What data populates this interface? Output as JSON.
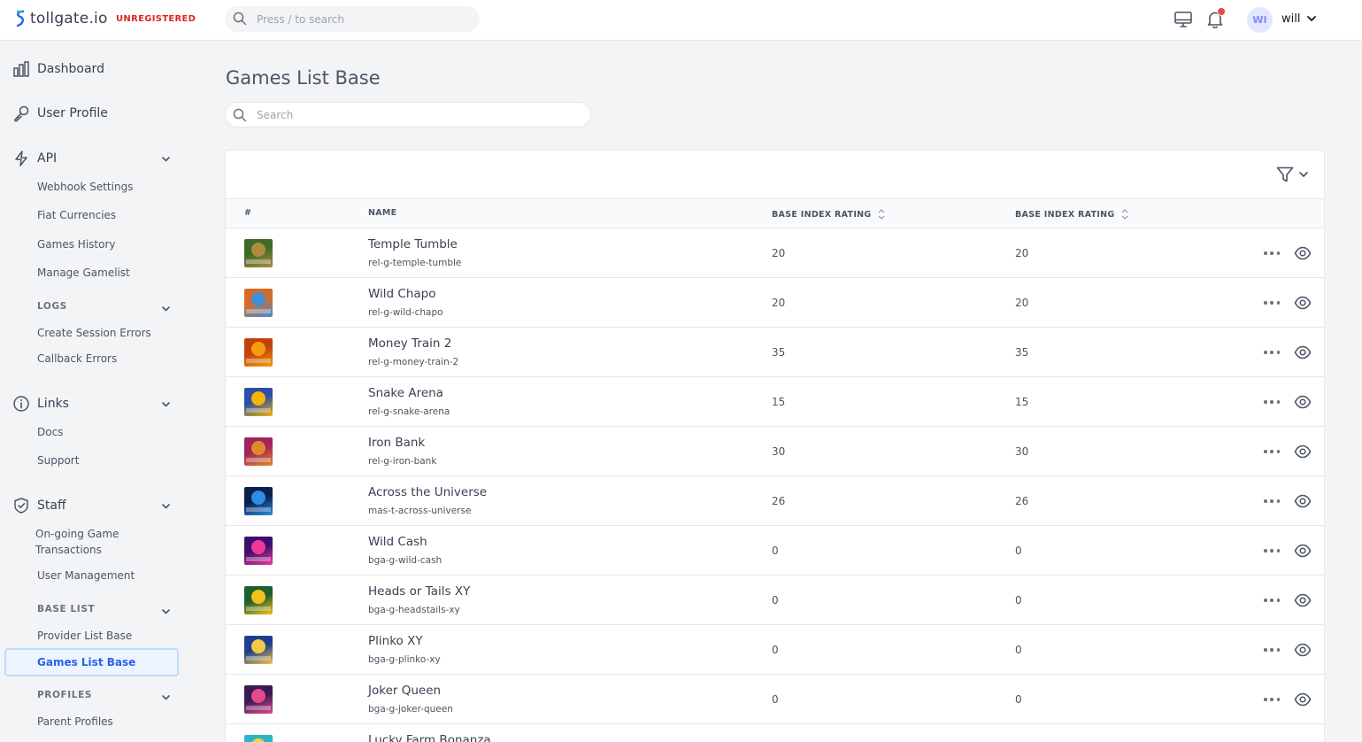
{
  "header": {
    "logo_text": "tollgate.io",
    "badge": "UNREGISTERED",
    "search_placeholder": "Press / to search",
    "avatar_initials": "WI",
    "username": "will"
  },
  "sidebar": {
    "dashboard": "Dashboard",
    "user_profile": "User Profile",
    "api": "API",
    "api_items": [
      "Webhook Settings",
      "Fiat Currencies",
      "Games History",
      "Manage Gamelist"
    ],
    "logs_section": "LOGS",
    "logs_items": [
      "Create Session Errors",
      "Callback Errors"
    ],
    "links": "Links",
    "links_items": [
      "Docs",
      "Support"
    ],
    "staff": "Staff",
    "staff_items": [
      "On-going Game Transactions",
      "User Management"
    ],
    "base_list_section": "BASE LIST",
    "base_list_items": [
      "Provider List Base",
      "Games List Base"
    ],
    "profiles_section": "PROFILES",
    "profiles_items": [
      "Parent Profiles"
    ]
  },
  "main": {
    "title": "Games List Base",
    "search_placeholder": "Search",
    "columns": [
      "#",
      "NAME",
      "BASE INDEX RATING",
      "BASE INDEX RATING"
    ],
    "rows": [
      {
        "name": "Temple Tumble",
        "slug": "rel-g-temple-tumble",
        "rating1": "20",
        "rating2": "20"
      },
      {
        "name": "Wild Chapo",
        "slug": "rel-g-wild-chapo",
        "rating1": "20",
        "rating2": "20"
      },
      {
        "name": "Money Train 2",
        "slug": "rel-g-money-train-2",
        "rating1": "35",
        "rating2": "35"
      },
      {
        "name": "Snake Arena",
        "slug": "rel-g-snake-arena",
        "rating1": "15",
        "rating2": "15"
      },
      {
        "name": "Iron Bank",
        "slug": "rel-g-iron-bank",
        "rating1": "30",
        "rating2": "30"
      },
      {
        "name": "Across the Universe",
        "slug": "mas-t-across-universe",
        "rating1": "26",
        "rating2": "26"
      },
      {
        "name": "Wild Cash",
        "slug": "bga-g-wild-cash",
        "rating1": "0",
        "rating2": "0"
      },
      {
        "name": "Heads or Tails XY",
        "slug": "bga-g-headstails-xy",
        "rating1": "0",
        "rating2": "0"
      },
      {
        "name": "Plinko XY",
        "slug": "bga-g-plinko-xy",
        "rating1": "0",
        "rating2": "0"
      },
      {
        "name": "Joker Queen",
        "slug": "bga-g-joker-queen",
        "rating1": "0",
        "rating2": "0"
      },
      {
        "name": "Lucky Farm Bonanza",
        "slug": "",
        "rating1": "",
        "rating2": ""
      }
    ]
  },
  "colors": {
    "accent": "#2563eb",
    "badge": "#dc2626",
    "notification_dot": "#ef4444",
    "thumb_colors": [
      [
        "#3f6b2a",
        "#b08a3c"
      ],
      [
        "#d46b2a",
        "#3f8fd8"
      ],
      [
        "#c2410c",
        "#f59e0b"
      ],
      [
        "#2b4fa8",
        "#f4b400"
      ],
      [
        "#a3245a",
        "#e08a2c"
      ],
      [
        "#0b1f4d",
        "#2b8fe6"
      ],
      [
        "#3b0f6e",
        "#f0389a"
      ],
      [
        "#1f5e2e",
        "#f2c21a"
      ],
      [
        "#1d3f8f",
        "#f6c744"
      ],
      [
        "#3a1a55",
        "#e24a8a"
      ],
      [
        "#2bb5c9",
        "#f3d53a"
      ]
    ]
  }
}
